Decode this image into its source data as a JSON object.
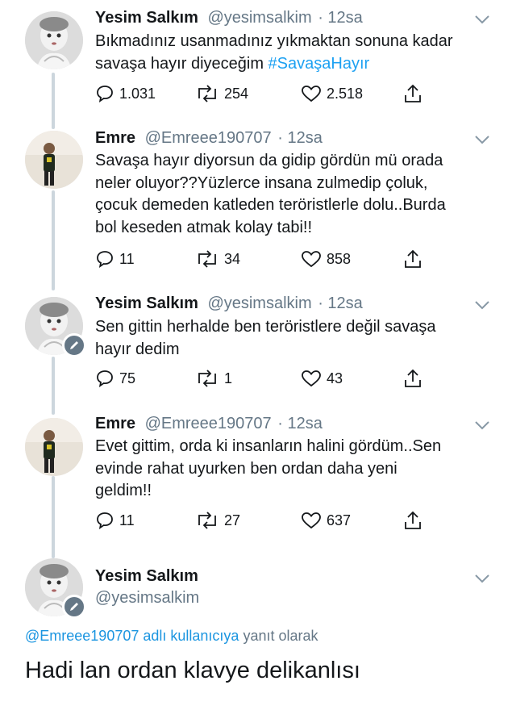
{
  "tweets": [
    {
      "name": "Yesim Salkım",
      "handle": "@yesimsalkim",
      "time": "· 12sa",
      "lines": [
        "Bıkmadınız usanmadınız yıkmaktan sonuna kadar",
        "savaşa hayır diyeceğim "
      ],
      "hashtag": "#SavaşaHayır",
      "replies": "1.031",
      "retweets": "254",
      "likes": "2.518"
    },
    {
      "name": "Emre",
      "handle": "@Emreee190707",
      "time": "· 12sa",
      "lines": [
        "Savaşa hayır diyorsun da gidip gördün mü orada",
        "neler oluyor??Yüzlerce insana zulmedip çoluk,",
        "çocuk demeden katleden teröristlerle dolu..Burda",
        "bol keseden atmak kolay tabi!!"
      ],
      "replies": "11",
      "retweets": "34",
      "likes": "858"
    },
    {
      "name": "Yesim Salkım",
      "handle": "@yesimsalkim",
      "time": "· 12sa",
      "lines": [
        "Sen gittin herhalde ben teröristlere değil savaşa",
        "hayır dedim"
      ],
      "replies": "75",
      "retweets": "1",
      "likes": "43"
    },
    {
      "name": "Emre",
      "handle": "@Emreee190707",
      "time": "· 12sa",
      "lines": [
        "Evet gittim, orda ki insanların halini gördüm..Sen",
        "evinde rahat uyurken ben ordan daha yeni",
        "geldim!!"
      ],
      "replies": "11",
      "retweets": "27",
      "likes": "637"
    }
  ],
  "focused": {
    "name": "Yesim Salkım",
    "handle": "@yesimsalkim",
    "reply_mention": "@Emreee190707 adlı kullanıcıya",
    "reply_suffix": " yanıt olarak",
    "text": "Hadi lan ordan klavye delikanlısı"
  },
  "icons": [
    "reply-icon",
    "retweet-icon",
    "like-icon",
    "share-icon",
    "chevron-down-icon",
    "pen-badge-icon"
  ],
  "colors": {
    "text": "#14171a",
    "secondary": "#657786",
    "link": "#1da1f2",
    "thread_line": "#ccd6dd"
  }
}
